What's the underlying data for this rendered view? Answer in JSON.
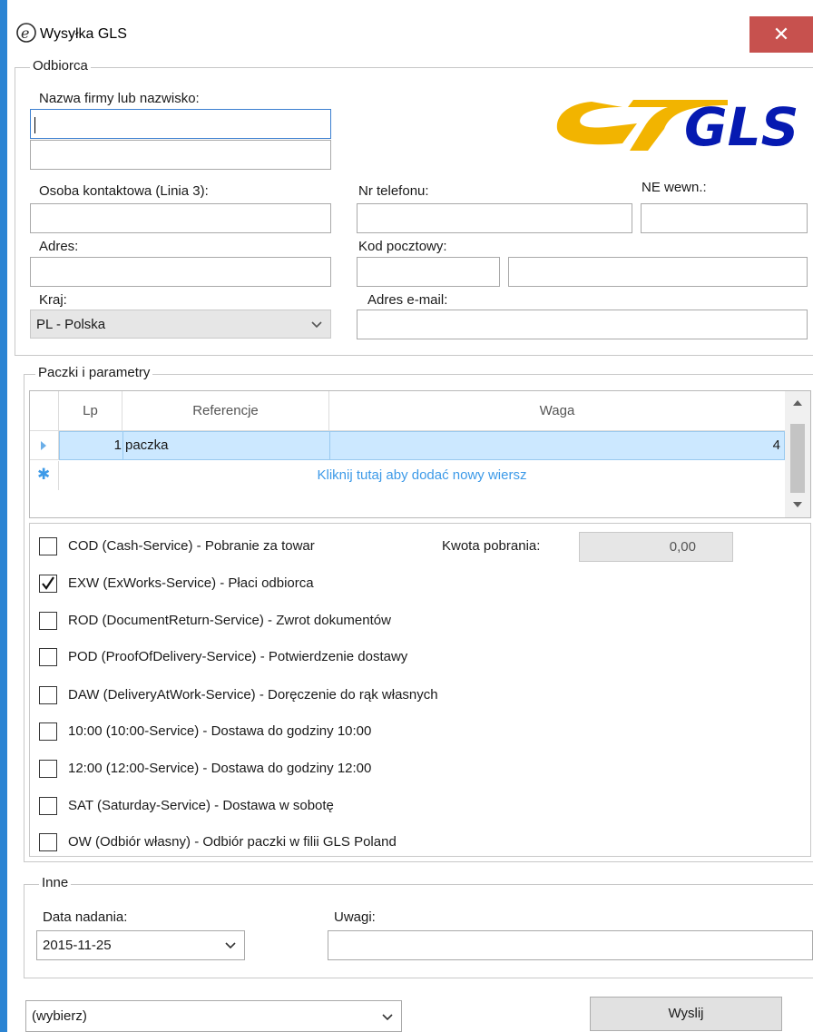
{
  "window": {
    "title": "Wysyłka GLS",
    "close_glyph": "✕",
    "icon": "app-e-icon"
  },
  "logo": {
    "text": "GLS",
    "accent_color": "#f2b400",
    "text_color": "#061ab1"
  },
  "recipient": {
    "group_label": "Odbiorca",
    "name_label": "Nazwa firmy lub nazwisko:",
    "name_value": "",
    "name2_value": "",
    "contact_label": "Osoba kontaktowa (Linia 3):",
    "phone_label": "Nr telefonu:",
    "ext_label": "NE wewn.:",
    "address_label": "Adres:",
    "postal_label": "Kod pocztowy:",
    "country_label": "Kraj:",
    "country_value": "PL  - Polska",
    "email_label": "Adres e-mail:"
  },
  "parcels": {
    "group_label": "Paczki i parametry",
    "columns": [
      "Lp",
      "Referencje",
      "Waga"
    ],
    "rows": [
      {
        "lp": "1",
        "ref": "paczka",
        "weight": "4"
      }
    ],
    "new_row_hint": "Kliknij tutaj aby dodać nowy wiersz",
    "cod_amount_label": "Kwota pobrania:",
    "cod_amount_value": "0,00",
    "services": [
      {
        "label": "COD (Cash-Service) - Pobranie za towar",
        "checked": false
      },
      {
        "label": "EXW (ExWorks-Service) - Płaci odbiorca",
        "checked": true
      },
      {
        "label": "ROD (DocumentReturn-Service) - Zwrot dokumentów",
        "checked": false
      },
      {
        "label": "POD (ProofOfDelivery-Service) - Potwierdzenie dostawy",
        "checked": false
      },
      {
        "label": "DAW (DeliveryAtWork-Service) - Doręczenie do rąk własnych",
        "checked": false
      },
      {
        "label": "10:00 (10:00-Service) - Dostawa do godziny 10:00",
        "checked": false
      },
      {
        "label": "12:00 (12:00-Service) - Dostawa do godziny 12:00",
        "checked": false
      },
      {
        "label": "SAT (Saturday-Service) - Dostawa w sobotę",
        "checked": false
      },
      {
        "label": "OW (Odbiór własny) - Odbiór paczki w filii GLS Poland",
        "checked": false
      }
    ]
  },
  "other": {
    "group_label": "Inne",
    "date_label": "Data nadania:",
    "date_value": "2015-11-25",
    "notes_label": "Uwagi:"
  },
  "footer": {
    "select_value": "(wybierz)",
    "send_label": "Wyslij"
  },
  "colors": {
    "title_frame": "#2b84d3",
    "close_button": "#c7514e",
    "selected_row": "#cce8ff",
    "hint_text": "#3d9ae8"
  }
}
